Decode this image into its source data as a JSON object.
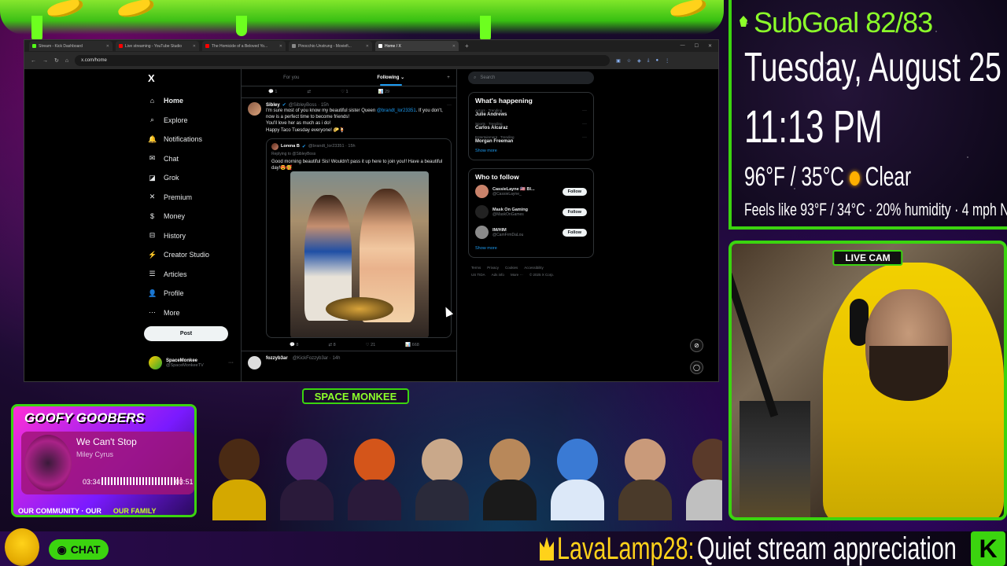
{
  "browser": {
    "tabs": [
      {
        "label": "Stream - Kick Dashboard",
        "color": "#53fc18",
        "active": false
      },
      {
        "label": "Live streaming - YouTube Studio",
        "color": "#ff0000",
        "active": false
      },
      {
        "label": "The Homicide of a Beloved Yo...",
        "color": "#ff0000",
        "active": false
      },
      {
        "label": "Pinocchio Unstrung - Moviefi...",
        "color": "#888888",
        "active": false
      },
      {
        "label": "Home / X",
        "color": "#ffffff",
        "active": true
      }
    ],
    "url": "x.com/home"
  },
  "x": {
    "logo": "X",
    "nav": [
      {
        "label": "Home",
        "icon": "⌂"
      },
      {
        "label": "Explore",
        "icon": "⌕"
      },
      {
        "label": "Notifications",
        "icon": "🔔"
      },
      {
        "label": "Chat",
        "icon": "✉"
      },
      {
        "label": "Grok",
        "icon": "◪"
      },
      {
        "label": "Premium",
        "icon": "✕"
      },
      {
        "label": "Money",
        "icon": "$"
      },
      {
        "label": "History",
        "icon": "⊟"
      },
      {
        "label": "Creator Studio",
        "icon": "⚡"
      },
      {
        "label": "Articles",
        "icon": "☰"
      },
      {
        "label": "Profile",
        "icon": "👤"
      },
      {
        "label": "More",
        "icon": "⋯"
      }
    ],
    "post_label": "Post",
    "profile": {
      "name": "SpaceMonkee",
      "handle": "@SpaceMonkeeTV"
    },
    "feed_tabs": [
      "For you",
      "Following"
    ],
    "prev_actions": {
      "replies": "1",
      "reposts": "",
      "likes": "1",
      "views": "29"
    },
    "tweet": {
      "name": "Sibley",
      "handle": "@SibleyBoss · 15h",
      "text_1": "I'm sure most of you know my beautiful sister Queen ",
      "mention": "@brandt_lor23351",
      "text_2": ". If you don't, now is a perfect time to become friends!",
      "text_3": "You'll love her as much as i do!",
      "text_4": "Happy Taco Tuesday everyone! 🌮🍹",
      "quote": {
        "name": "Lorena B",
        "handle": "@brandt_lor23351 · 15h",
        "replying": "Replying to @SibleyBoss",
        "text": "Good morning beautiful Sis! Wouldn't pass it up here to join you!! Have a beautiful day!😍🥰"
      },
      "actions": {
        "replies": "8",
        "reposts": "8",
        "likes": "21",
        "views": "668"
      }
    },
    "next_tweet": {
      "name": "fozzyb3ar",
      "handle": "@KickFozzyb3ar · 14h"
    },
    "search_placeholder": "Search",
    "whats_happening": {
      "title": "What's happening",
      "trends": [
        {
          "category": "Actors · Trending",
          "name": "Julie Andrews"
        },
        {
          "category": "Sports · Trending",
          "name": "Carlos Alcaraz"
        },
        {
          "category": "Entertainment · Trending",
          "name": "Morgan Freeman"
        }
      ],
      "show_more": "Show more"
    },
    "who_to_follow": {
      "title": "Who to follow",
      "accounts": [
        {
          "name": "CassieLayne 🇺🇸 Bl...",
          "handle": "@CassieLayne_",
          "color": "#c9826a"
        },
        {
          "name": "Mask On Gaming",
          "handle": "@MaskOnGames",
          "color": "#222222"
        },
        {
          "name": "IM/HIM",
          "handle": "@CamFrmDaLou",
          "color": "#8a8a8a"
        }
      ],
      "follow_label": "Follow",
      "show_more": "Show more"
    },
    "footer": [
      "Terms",
      "Privacy",
      "Cookies",
      "Accessibility",
      "US TIDA",
      "Ads info",
      "More ···",
      "© 2025 X Corp."
    ]
  },
  "overlay": {
    "subgoal": "SubGoal 82/83",
    "date": "Tuesday, August 25",
    "time": "11:13 PM",
    "weather": "96°F / 35°C",
    "condition": "Clear",
    "feels": "Feels like 93°F / 34°C · 20% humidity · 4 mph NW",
    "live_cam": "LIVE CAM",
    "channel": "SPACE MONKEE",
    "goofy_title": "GOOFY GOOBERS",
    "song": "We Can't Stop",
    "artist": "Miley Cyrus",
    "time_current": "03:34",
    "time_total": "03:51",
    "progress": 0.93,
    "community_1": "OUR COMMUNITY · OUR",
    "community_2": "OUR FAMILY",
    "chat_label": "CHAT",
    "ticker_user": "LavaLamp28:",
    "ticker_msg": "Quiet stream appreciation",
    "kick_logo": "K",
    "avatar_colors": [
      [
        "#4a2a14",
        "#d4a800"
      ],
      [
        "#5a2a7a",
        "#2a1a3a"
      ],
      [
        "#d4551a",
        "#2a1a3a"
      ],
      [
        "#c9a88a",
        "#2a2a3a"
      ],
      [
        "#b8885a",
        "#1a1a1a"
      ],
      [
        "#3a7ad4",
        "#dce8f8"
      ],
      [
        "#c99a7a",
        "#4a3a2a"
      ],
      [
        "#5a3a2a",
        "#c0c0c0"
      ]
    ]
  }
}
